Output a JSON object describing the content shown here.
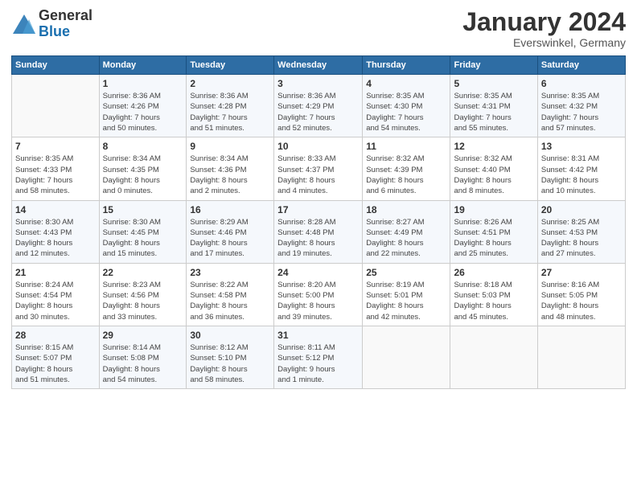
{
  "header": {
    "logo_general": "General",
    "logo_blue": "Blue",
    "month_title": "January 2024",
    "location": "Everswinkel, Germany"
  },
  "calendar": {
    "days_of_week": [
      "Sunday",
      "Monday",
      "Tuesday",
      "Wednesday",
      "Thursday",
      "Friday",
      "Saturday"
    ],
    "weeks": [
      [
        {
          "day": "",
          "info": ""
        },
        {
          "day": "1",
          "info": "Sunrise: 8:36 AM\nSunset: 4:26 PM\nDaylight: 7 hours\nand 50 minutes."
        },
        {
          "day": "2",
          "info": "Sunrise: 8:36 AM\nSunset: 4:28 PM\nDaylight: 7 hours\nand 51 minutes."
        },
        {
          "day": "3",
          "info": "Sunrise: 8:36 AM\nSunset: 4:29 PM\nDaylight: 7 hours\nand 52 minutes."
        },
        {
          "day": "4",
          "info": "Sunrise: 8:35 AM\nSunset: 4:30 PM\nDaylight: 7 hours\nand 54 minutes."
        },
        {
          "day": "5",
          "info": "Sunrise: 8:35 AM\nSunset: 4:31 PM\nDaylight: 7 hours\nand 55 minutes."
        },
        {
          "day": "6",
          "info": "Sunrise: 8:35 AM\nSunset: 4:32 PM\nDaylight: 7 hours\nand 57 minutes."
        }
      ],
      [
        {
          "day": "7",
          "info": "Sunrise: 8:35 AM\nSunset: 4:33 PM\nDaylight: 7 hours\nand 58 minutes."
        },
        {
          "day": "8",
          "info": "Sunrise: 8:34 AM\nSunset: 4:35 PM\nDaylight: 8 hours\nand 0 minutes."
        },
        {
          "day": "9",
          "info": "Sunrise: 8:34 AM\nSunset: 4:36 PM\nDaylight: 8 hours\nand 2 minutes."
        },
        {
          "day": "10",
          "info": "Sunrise: 8:33 AM\nSunset: 4:37 PM\nDaylight: 8 hours\nand 4 minutes."
        },
        {
          "day": "11",
          "info": "Sunrise: 8:32 AM\nSunset: 4:39 PM\nDaylight: 8 hours\nand 6 minutes."
        },
        {
          "day": "12",
          "info": "Sunrise: 8:32 AM\nSunset: 4:40 PM\nDaylight: 8 hours\nand 8 minutes."
        },
        {
          "day": "13",
          "info": "Sunrise: 8:31 AM\nSunset: 4:42 PM\nDaylight: 8 hours\nand 10 minutes."
        }
      ],
      [
        {
          "day": "14",
          "info": "Sunrise: 8:30 AM\nSunset: 4:43 PM\nDaylight: 8 hours\nand 12 minutes."
        },
        {
          "day": "15",
          "info": "Sunrise: 8:30 AM\nSunset: 4:45 PM\nDaylight: 8 hours\nand 15 minutes."
        },
        {
          "day": "16",
          "info": "Sunrise: 8:29 AM\nSunset: 4:46 PM\nDaylight: 8 hours\nand 17 minutes."
        },
        {
          "day": "17",
          "info": "Sunrise: 8:28 AM\nSunset: 4:48 PM\nDaylight: 8 hours\nand 19 minutes."
        },
        {
          "day": "18",
          "info": "Sunrise: 8:27 AM\nSunset: 4:49 PM\nDaylight: 8 hours\nand 22 minutes."
        },
        {
          "day": "19",
          "info": "Sunrise: 8:26 AM\nSunset: 4:51 PM\nDaylight: 8 hours\nand 25 minutes."
        },
        {
          "day": "20",
          "info": "Sunrise: 8:25 AM\nSunset: 4:53 PM\nDaylight: 8 hours\nand 27 minutes."
        }
      ],
      [
        {
          "day": "21",
          "info": "Sunrise: 8:24 AM\nSunset: 4:54 PM\nDaylight: 8 hours\nand 30 minutes."
        },
        {
          "day": "22",
          "info": "Sunrise: 8:23 AM\nSunset: 4:56 PM\nDaylight: 8 hours\nand 33 minutes."
        },
        {
          "day": "23",
          "info": "Sunrise: 8:22 AM\nSunset: 4:58 PM\nDaylight: 8 hours\nand 36 minutes."
        },
        {
          "day": "24",
          "info": "Sunrise: 8:20 AM\nSunset: 5:00 PM\nDaylight: 8 hours\nand 39 minutes."
        },
        {
          "day": "25",
          "info": "Sunrise: 8:19 AM\nSunset: 5:01 PM\nDaylight: 8 hours\nand 42 minutes."
        },
        {
          "day": "26",
          "info": "Sunrise: 8:18 AM\nSunset: 5:03 PM\nDaylight: 8 hours\nand 45 minutes."
        },
        {
          "day": "27",
          "info": "Sunrise: 8:16 AM\nSunset: 5:05 PM\nDaylight: 8 hours\nand 48 minutes."
        }
      ],
      [
        {
          "day": "28",
          "info": "Sunrise: 8:15 AM\nSunset: 5:07 PM\nDaylight: 8 hours\nand 51 minutes."
        },
        {
          "day": "29",
          "info": "Sunrise: 8:14 AM\nSunset: 5:08 PM\nDaylight: 8 hours\nand 54 minutes."
        },
        {
          "day": "30",
          "info": "Sunrise: 8:12 AM\nSunset: 5:10 PM\nDaylight: 8 hours\nand 58 minutes."
        },
        {
          "day": "31",
          "info": "Sunrise: 8:11 AM\nSunset: 5:12 PM\nDaylight: 9 hours\nand 1 minute."
        },
        {
          "day": "",
          "info": ""
        },
        {
          "day": "",
          "info": ""
        },
        {
          "day": "",
          "info": ""
        }
      ]
    ]
  }
}
